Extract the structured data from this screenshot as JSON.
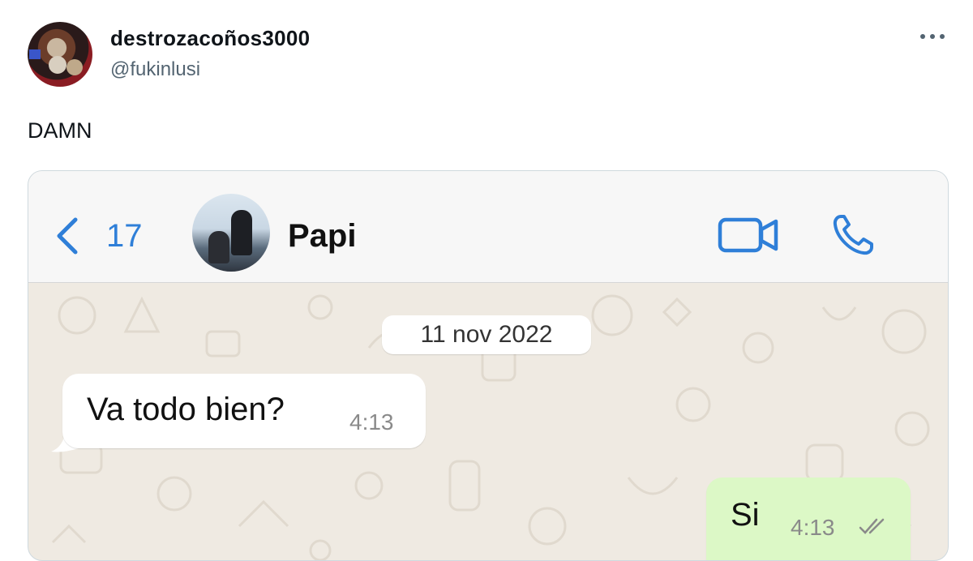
{
  "tweet": {
    "display_name": "destrozacoños3000",
    "handle": "@fukinlusi",
    "text": "DAMN",
    "more_icon": "more-horizontal-icon"
  },
  "chat": {
    "back_count": "17",
    "contact_name": "Papi",
    "icons": {
      "back": "chevron-left-icon",
      "video": "video-camera-icon",
      "call": "phone-icon",
      "read": "double-check-icon"
    },
    "date_label": "11 nov 2022",
    "messages": [
      {
        "direction": "incoming",
        "text": "Va todo bien?",
        "time": "4:13"
      },
      {
        "direction": "outgoing",
        "text": "Si",
        "time": "4:13"
      }
    ]
  },
  "colors": {
    "accent": "#2f7fd8",
    "chat_background": "#efeae2",
    "incoming_bubble": "#ffffff",
    "outgoing_bubble": "#dcf8c6",
    "handle_gray": "#536471"
  }
}
